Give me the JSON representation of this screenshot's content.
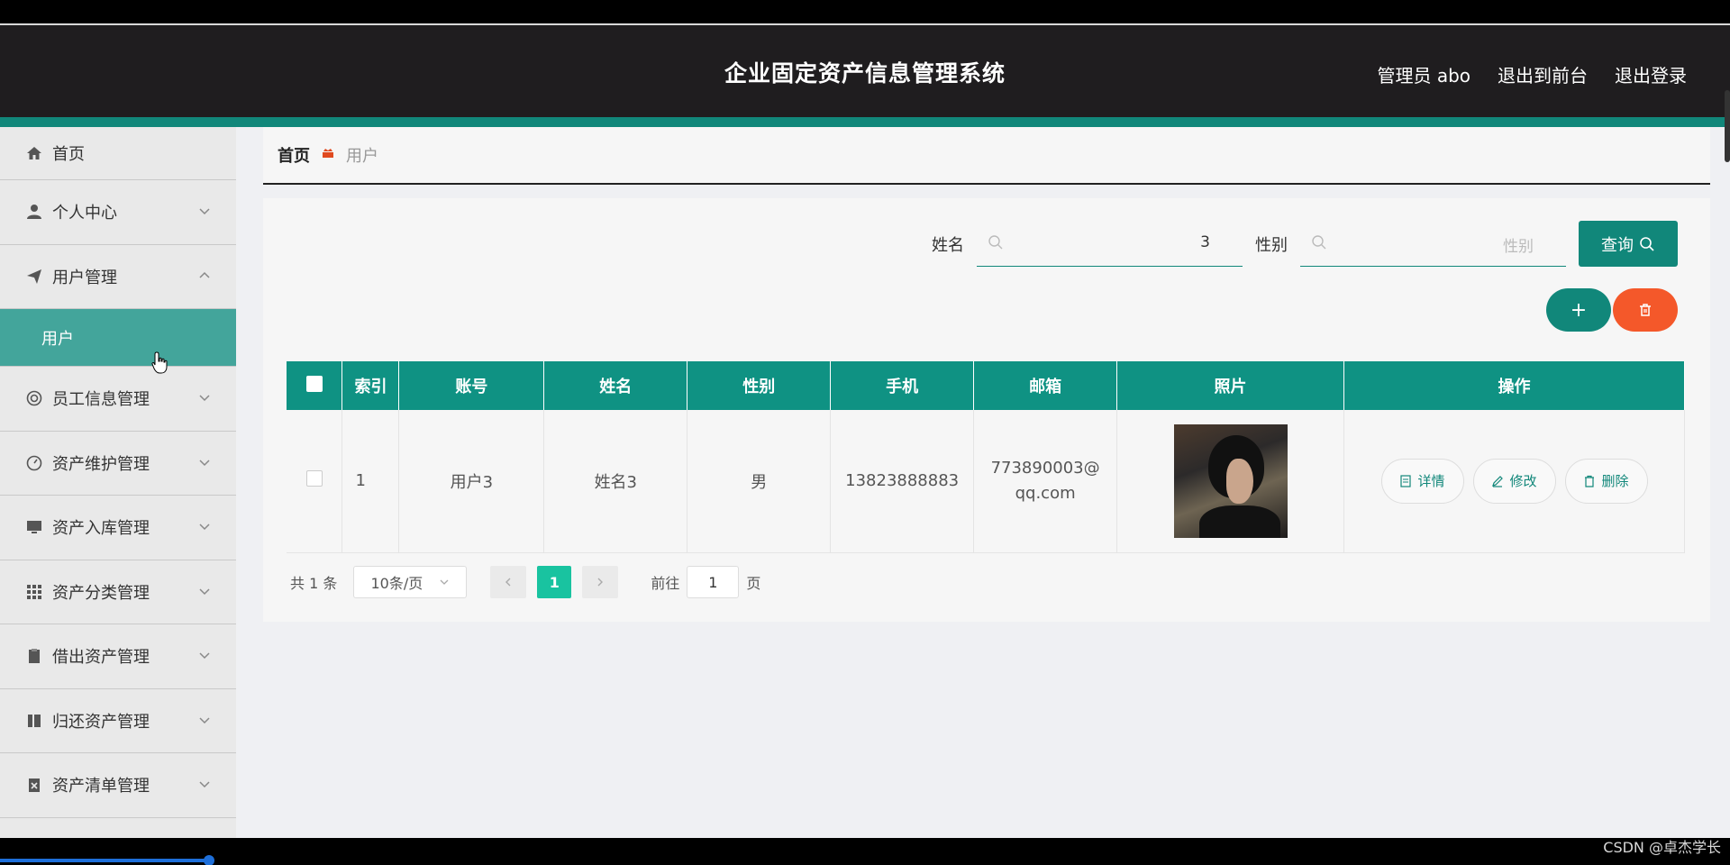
{
  "header": {
    "title": "企业固定资产信息管理系统",
    "user_prefix": "管理员",
    "user_name": "abo",
    "front_link": "退出到前台",
    "logout_link": "退出登录"
  },
  "sidebar": {
    "items": [
      {
        "label": "首页",
        "icon": "home-icon"
      },
      {
        "label": "个人中心",
        "icon": "user-icon"
      },
      {
        "label": "用户管理",
        "icon": "send-icon"
      },
      {
        "label": "员工信息管理",
        "icon": "lifebuoy-icon"
      },
      {
        "label": "资产维护管理",
        "icon": "gauge-icon"
      },
      {
        "label": "资产入库管理",
        "icon": "monitor-icon"
      },
      {
        "label": "资产分类管理",
        "icon": "grid-icon"
      },
      {
        "label": "借出资产管理",
        "icon": "clipboard-icon"
      },
      {
        "label": "归还资产管理",
        "icon": "book-icon"
      },
      {
        "label": "资产清单管理",
        "icon": "clipboard-x-icon"
      }
    ],
    "sub_active": "用户"
  },
  "breadcrumb": {
    "home": "首页",
    "current": "用户"
  },
  "search": {
    "name_label": "姓名",
    "name_value": "3",
    "sex_label": "性别",
    "sex_placeholder": "性别",
    "query_label": "查询"
  },
  "actions": {
    "add": "+"
  },
  "table": {
    "headers": [
      "索引",
      "账号",
      "姓名",
      "性别",
      "手机",
      "邮箱",
      "照片",
      "操作"
    ],
    "rows": [
      {
        "index": "1",
        "account": "用户3",
        "name": "姓名3",
        "sex": "男",
        "phone": "13823888883",
        "email": "773890003@qq.com"
      }
    ],
    "ops": {
      "detail": "详情",
      "edit": "修改",
      "delete": "删除"
    }
  },
  "pager": {
    "total": "共 1 条",
    "size": "10条/页",
    "page": "1",
    "goto_prefix": "前往",
    "goto_value": "1",
    "goto_suffix": "页"
  },
  "watermark": "CSDN @卓杰学长",
  "colors": {
    "teal": "#11877a",
    "table_header": "#0f9283",
    "danger": "#f4582a",
    "pager_active": "#19c3a0"
  }
}
